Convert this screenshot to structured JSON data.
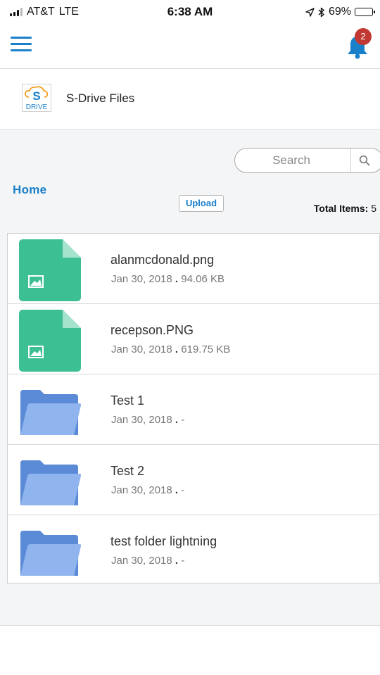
{
  "status_bar": {
    "carrier": "AT&T",
    "network": "LTE",
    "time": "6:38 AM",
    "battery": "69%",
    "battery_level": 0.69
  },
  "nav": {
    "notification_count": "2",
    "accent_color": "#1a80c9",
    "badge_color": "#c23934"
  },
  "app": {
    "logo_text": "DRIVE",
    "title": "S-Drive Files"
  },
  "toolbar": {
    "search_placeholder": "Search",
    "home_label": "Home",
    "upload_label": "Upload",
    "total_items_label": "Total Items:",
    "total_items_count": "5"
  },
  "files": [
    {
      "name": "alanmcdonald.png",
      "date": "Jan 30, 2018",
      "separator": ".",
      "size": "94.06 KB",
      "type": "image-file-icon"
    },
    {
      "name": "recepson.PNG",
      "date": "Jan 30, 2018",
      "separator": ".",
      "size": "619.75 KB",
      "type": "image-file-icon"
    },
    {
      "name": "Test 1",
      "date": "Jan 30, 2018",
      "separator": ".",
      "size": "-",
      "type": "folder-icon"
    },
    {
      "name": "Test 2",
      "date": "Jan 30, 2018",
      "separator": ".",
      "size": "-",
      "type": "folder-icon"
    },
    {
      "name": "test folder lightning",
      "date": "Jan 30, 2018",
      "separator": ".",
      "size": "-",
      "type": "folder-icon"
    }
  ]
}
